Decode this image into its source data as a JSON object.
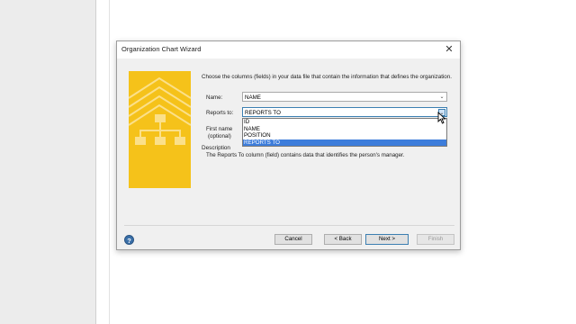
{
  "dialog": {
    "title": "Organization Chart Wizard",
    "instructions": "Choose the columns (fields) in your data file that contain the information that defines the organization."
  },
  "fields": {
    "name_label": "Name:",
    "name_value": "NAME",
    "reports_label": "Reports to:",
    "reports_value": "REPORTS TO",
    "first_name_label": "First name",
    "first_name_note": "(optional)"
  },
  "dropdown": {
    "options": [
      "ID",
      "NAME",
      "POSITION",
      "REPORTS TO"
    ],
    "selected": "REPORTS TO"
  },
  "description": {
    "title": "Description",
    "text": "The Reports To column (field) contains data that identifies the person's manager."
  },
  "buttons": {
    "cancel": "Cancel",
    "back": "< Back",
    "next": "Next >",
    "finish": "Finish"
  },
  "icons": {
    "close": "close-icon",
    "help": "help-icon",
    "dropdown": "chevron-down-icon"
  },
  "colors": {
    "banner": "#f5c21a",
    "selection": "#3d7ddb",
    "help": "#3a6fa8"
  }
}
